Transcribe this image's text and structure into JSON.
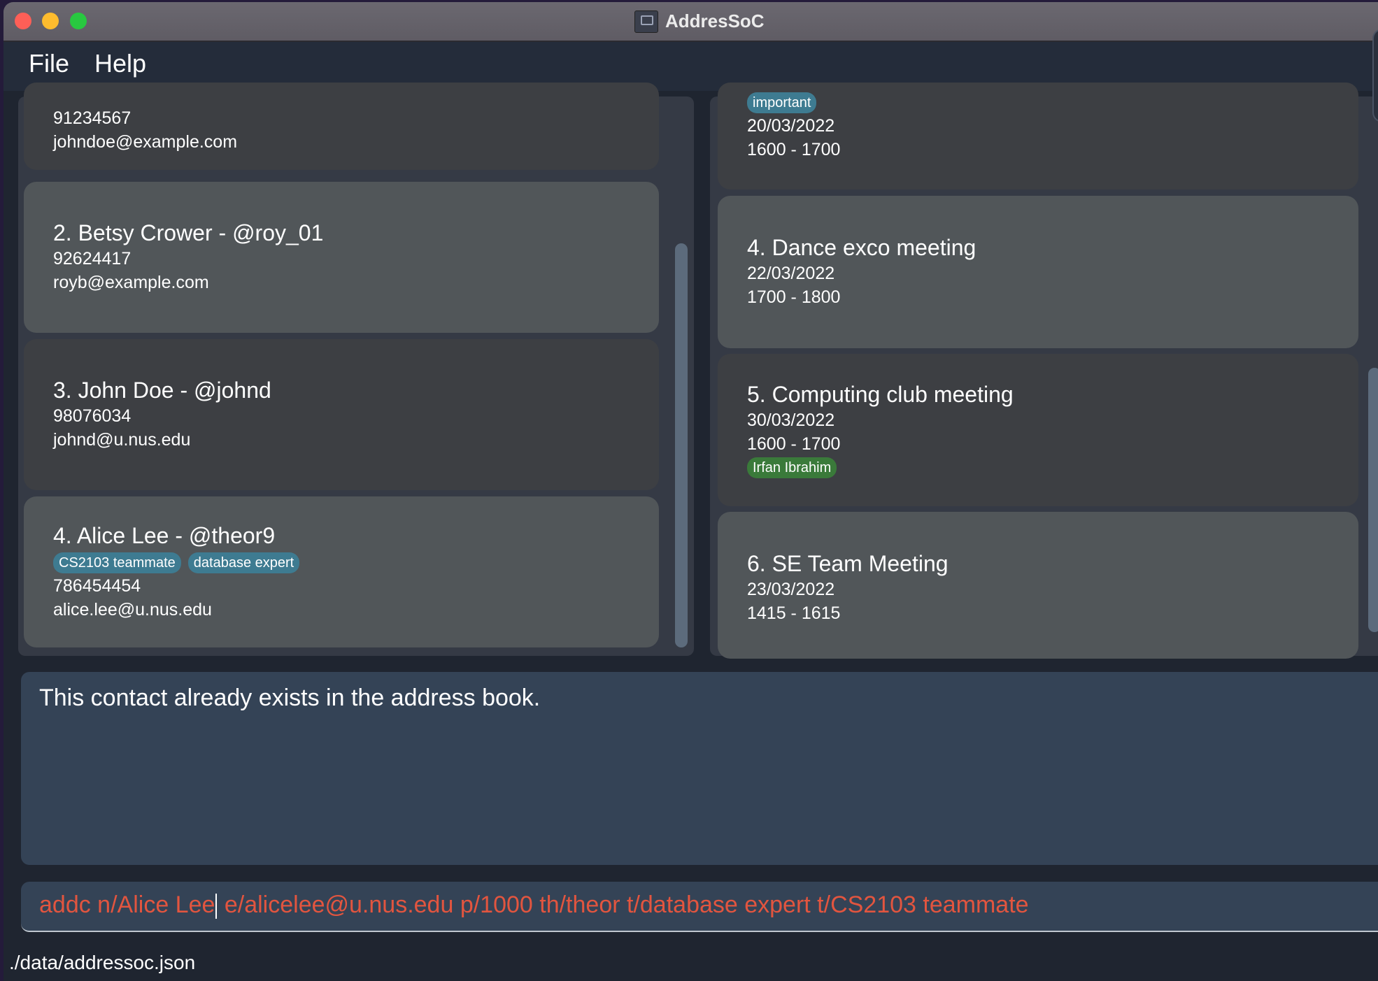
{
  "window": {
    "title": "AddresSoC",
    "app_icon": "app-icon"
  },
  "menu": {
    "file": "File",
    "help": "Help"
  },
  "contacts": [
    {
      "title": "",
      "phone": "91234567",
      "email": "johndoe@example.com",
      "tags": []
    },
    {
      "title": "2.  Betsy Crower - @roy_01",
      "phone": "92624417",
      "email": "royb@example.com",
      "tags": []
    },
    {
      "title": "3.  John Doe - @johnd",
      "phone": "98076034",
      "email": "johnd@u.nus.edu",
      "tags": []
    },
    {
      "title": "4.  Alice Lee - @theor9",
      "phone": "786454454",
      "email": "alice.lee@u.nus.edu",
      "tags": [
        "CS2103 teammate",
        "database expert"
      ]
    }
  ],
  "events": [
    {
      "title": "",
      "date": "20/03/2022",
      "time": "1600 - 1700",
      "tags": [
        "important"
      ]
    },
    {
      "title": "4.  Dance exco meeting",
      "date": "22/03/2022",
      "time": "1700 - 1800",
      "tags": []
    },
    {
      "title": "5.  Computing club meeting",
      "date": "30/03/2022",
      "time": "1600 - 1700",
      "participants": [
        "Irfan Ibrahim"
      ]
    },
    {
      "title": "6.  SE Team Meeting",
      "date": "23/03/2022",
      "time": "1415 - 1615",
      "tags": []
    }
  ],
  "result_display": {
    "message": "This contact already exists in the address book."
  },
  "command_box": {
    "before_caret": "addc n/Alice Lee",
    "after_caret": " e/alicelee@u.nus.edu p/1000 th/theor t/database expert t/CS2103 teammate",
    "text_color": "#e2553f"
  },
  "status_bar": {
    "file_path": "./data/addressoc.json"
  },
  "colors": {
    "tag_blue": "#3e7b91",
    "tag_green": "#3a7a3a",
    "card_dark": "#3d3f43",
    "card_light": "#515659",
    "panel_bg": "#344356"
  }
}
